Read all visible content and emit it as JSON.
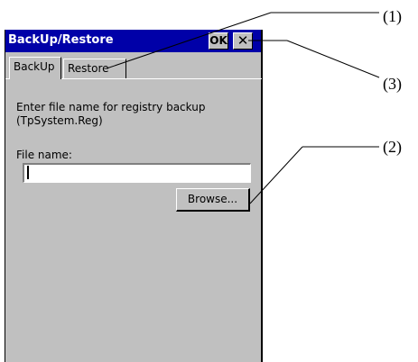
{
  "window": {
    "title": "BackUp/Restore",
    "ok_label": "OK",
    "close_symbol": "✕"
  },
  "tabs": [
    {
      "label": "BackUp"
    },
    {
      "label": "Restore"
    }
  ],
  "instruction": {
    "line1": "Enter file name for registry backup",
    "line2": "(TpSystem.Reg)"
  },
  "file_name": {
    "label": "File name:",
    "value": ""
  },
  "browse_label": "Browse...",
  "callouts": [
    {
      "label": "(1)"
    },
    {
      "label": "(3)"
    },
    {
      "label": "(2)"
    }
  ],
  "colors": {
    "titlebar": "#0000a8",
    "face": "#c0c0c0"
  }
}
